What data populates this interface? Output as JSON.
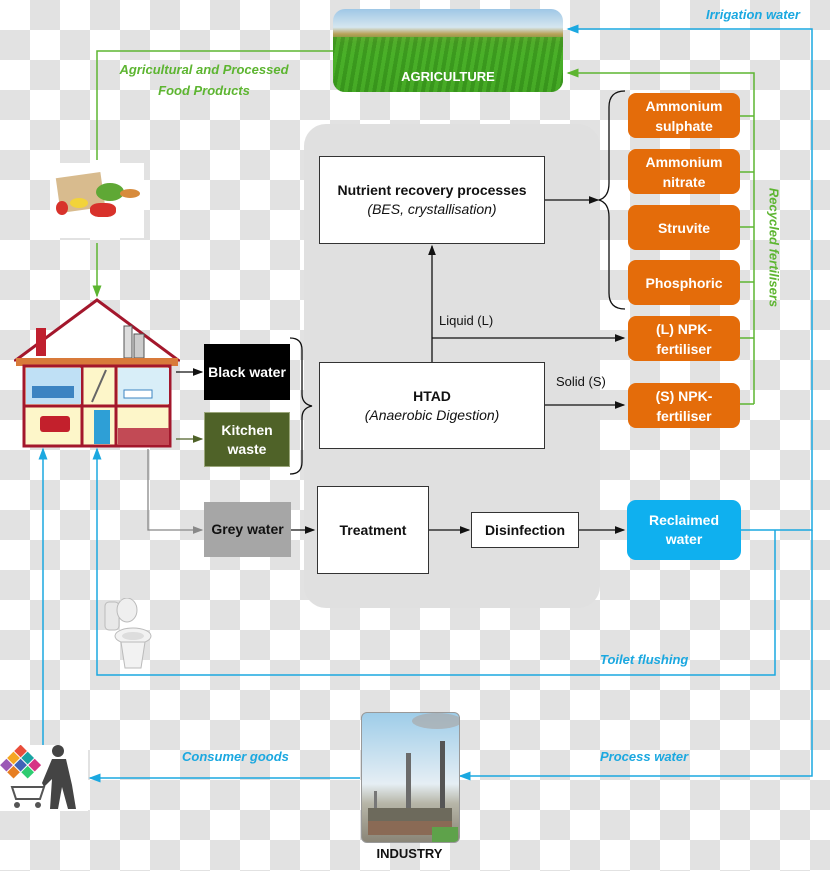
{
  "nodes": {
    "agriculture": "AGRICULTURE",
    "industry": "INDUSTRY",
    "nutrient_recovery": {
      "title": "Nutrient recovery processes",
      "subtitle": "(BES, crystallisation)"
    },
    "htad": {
      "title": "HTAD",
      "subtitle": "(Anaerobic Digestion)"
    },
    "black_water": "Black water",
    "kitchen_waste": [
      "Kitchen",
      "waste"
    ],
    "grey_water": "Grey water",
    "treatment": "Treatment",
    "disinfection": "Disinfection",
    "reclaimed_water": [
      "Reclaimed",
      "water"
    ]
  },
  "fertilisers": [
    [
      "Ammonium",
      "sulphate"
    ],
    [
      "Ammonium",
      "nitrate"
    ],
    [
      "Struvite"
    ],
    [
      "Phosphoric"
    ],
    [
      "(L) NPK-",
      "fertiliser"
    ],
    [
      "(S) NPK-",
      "fertiliser"
    ]
  ],
  "flow_labels": {
    "liquid": "Liquid (L)",
    "solid": "Solid (S)",
    "agri_products": [
      "Agricultural and Processed",
      "Food Products"
    ],
    "irrigation": "Irrigation water",
    "recycled_fertilisers": "Recycled fertilisers",
    "toilet_flushing": "Toilet flushing",
    "consumer_goods": "Consumer goods",
    "process_water": "Process water"
  },
  "icons": {
    "house": "house-cutaway-icon",
    "food_bag": "grocery-bag-icon",
    "toilet": "toilet-icon",
    "shopper": "shopping-cart-person-icon",
    "factory": "factory-icon",
    "field": "farm-field-icon"
  },
  "colors": {
    "orange": "#e46c0a",
    "green_flow": "#5db531",
    "blue_flow": "#1ba8e0",
    "black_water": "#000000",
    "kitchen_waste": "#4f6228",
    "grey_water": "#a6a6a6",
    "reclaimed": "#0fb0ef"
  }
}
